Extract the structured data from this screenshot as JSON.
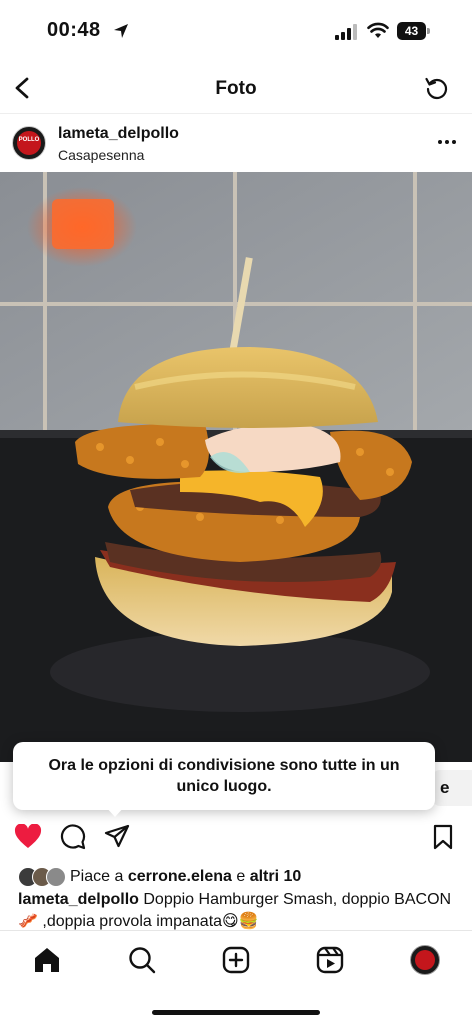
{
  "status_bar": {
    "time": "00:48",
    "battery": "43",
    "battery_level": 0.43,
    "icons": [
      "location-arrow-icon",
      "signal-icon",
      "wifi-icon",
      "battery-icon"
    ]
  },
  "header": {
    "title": "Foto",
    "icons": [
      "back-chevron-icon",
      "refresh-icon"
    ]
  },
  "post": {
    "username": "lameta_delpollo",
    "location": "Casapesenna",
    "avatar_text": "POLLO",
    "image_description_icon": "burger-photo"
  },
  "tooltip": {
    "line1": "Ora le opzioni di condivisione sono tutte in un",
    "line2": "unico luogo.",
    "partial_button_text": "e"
  },
  "actions": {
    "liked": true,
    "heart_color": "#ed1c40",
    "icons": [
      "heart-icon",
      "comment-icon",
      "share-icon",
      "bookmark-icon"
    ]
  },
  "likes": {
    "prefix": "Piace a",
    "user": "cerrone.elena",
    "joiner": "e",
    "others": "altri 10"
  },
  "caption": {
    "username": "lameta_delpollo",
    "text": "Doppio Hamburger Smash, doppio BACON 🥓 ,doppia provola impanata😋🍔"
  },
  "bottom_nav": {
    "items": [
      "home-icon",
      "search-icon",
      "create-icon",
      "reels-icon",
      "profile-avatar"
    ]
  }
}
